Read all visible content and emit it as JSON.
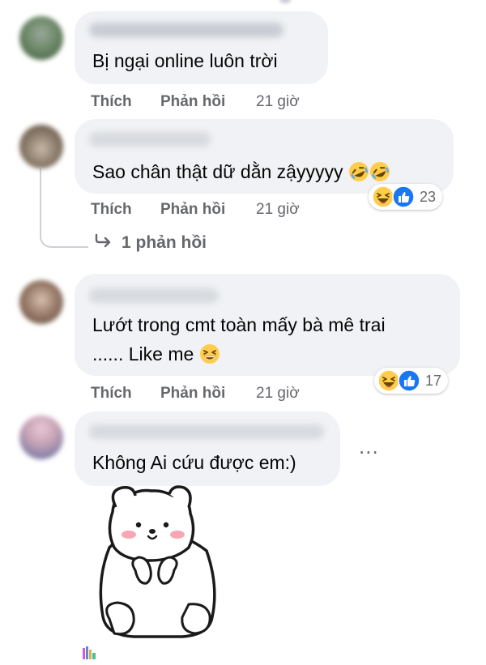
{
  "comments": [
    {
      "text": "Bị ngại online luôn trời",
      "actions": {
        "like": "Thích",
        "reply": "Phản hồi",
        "time": "21 giờ"
      }
    },
    {
      "text": "Sao chân thật dữ dằn zậyyyyy",
      "text_emojis": [
        "rolling-laughing",
        "rolling-laughing"
      ],
      "reactions": {
        "icons": [
          "haha",
          "like"
        ],
        "count": "23"
      },
      "actions": {
        "like": "Thích",
        "reply": "Phản hồi",
        "time": "21 giờ"
      },
      "replies_link": "1 phản hồi"
    },
    {
      "text_lines": [
        "Lướt trong cmt toàn mấy bà mê trai",
        "...... Like me"
      ],
      "text_emojis": [
        "grinning-squint"
      ],
      "reactions": {
        "icons": [
          "haha",
          "like"
        ],
        "count": "17"
      },
      "actions": {
        "like": "Thích",
        "reply": "Phản hồi",
        "time": "21 giờ"
      }
    },
    {
      "text": "Không Ai cứu được em:)",
      "sticker": "shy-polar-bear",
      "more": "..."
    }
  ],
  "colors": {
    "bubble": "#f0f2f5",
    "meta_text": "#65676b",
    "like_blue": "#1877f2",
    "haha_yellow": "#ffcc4d"
  }
}
